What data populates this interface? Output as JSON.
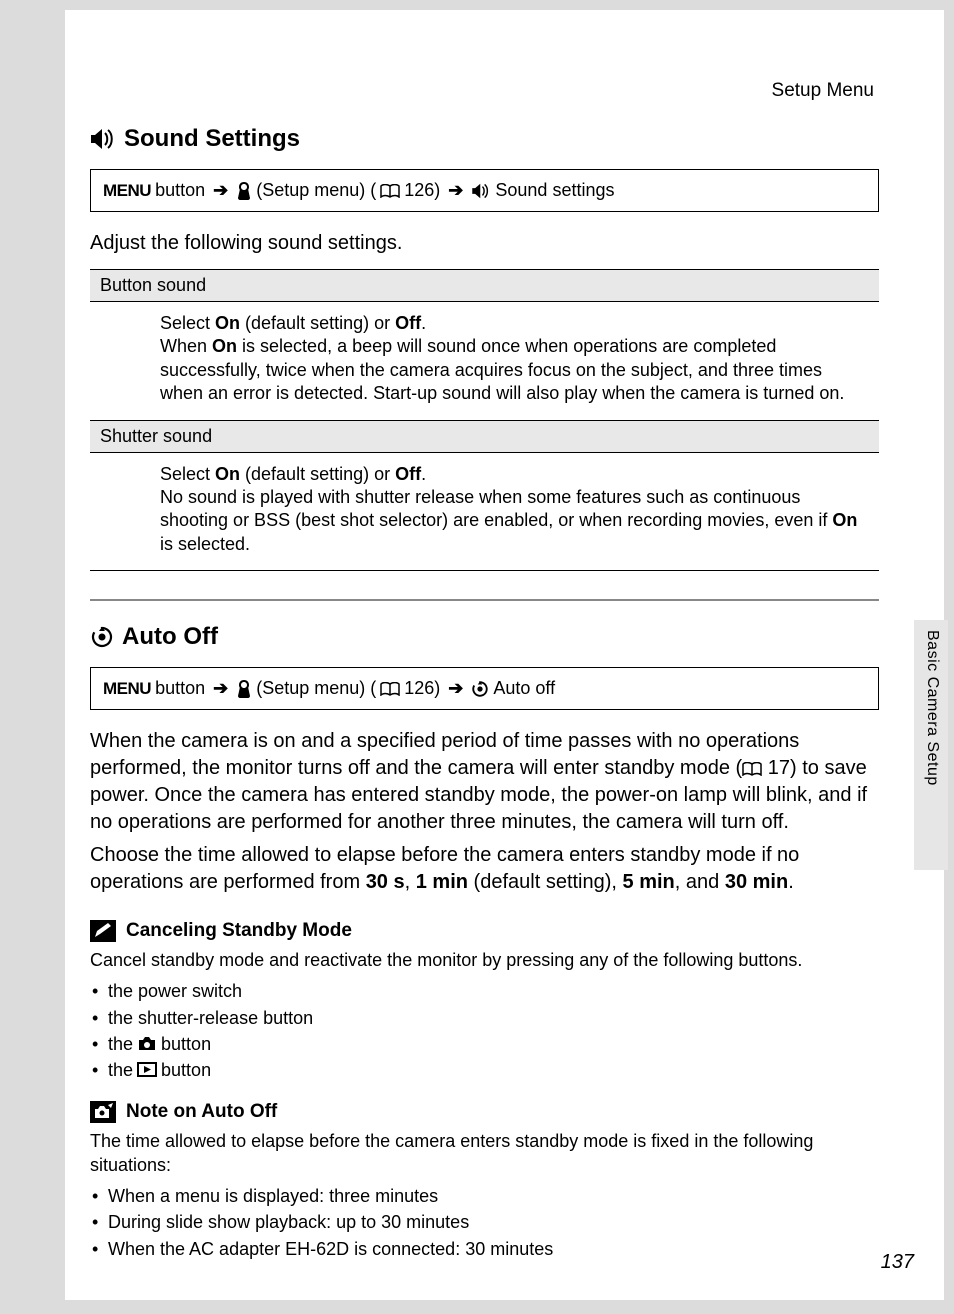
{
  "running_head": "Setup Menu",
  "side_tab": "Basic Camera Setup",
  "page_number": "137",
  "sound": {
    "title": "Sound Settings",
    "nav": {
      "menu": "MENU",
      "btn": " button ",
      "setup": " (Setup menu) (",
      "page": " 126) ",
      "last": " Sound settings"
    },
    "intro": "Adjust the following sound settings.",
    "options": [
      {
        "name": "Button sound",
        "body_pre": "Select ",
        "on": "On",
        "mid1": " (default setting) or ",
        "off": "Off",
        "mid2": ".",
        "line2a": "When ",
        "line2b": " is selected, a beep will sound once when operations are completed successfully, twice when the camera acquires focus on the subject, and three times when an error is detected. Start-up sound will also play when the camera is turned on."
      },
      {
        "name": "Shutter sound",
        "body_pre": "Select ",
        "on": "On",
        "mid1": " (default setting) or ",
        "off": "Off",
        "mid2": ".",
        "line2": "No sound is played with shutter release when some features such as continuous shooting or BSS (best shot selector) are enabled, or when recording movies, even if ",
        "line2b": " is selected."
      }
    ]
  },
  "autooff": {
    "title": "Auto Off",
    "nav": {
      "menu": "MENU",
      "btn": " button ",
      "setup": " (Setup menu) (",
      "page": " 126) ",
      "last": " Auto off"
    },
    "para1a": "When the camera is on and a specified period of time passes with no operations performed, the monitor turns off and the camera will enter standby mode (",
    "para1_page": " 17) to save power. Once the camera has entered standby mode, the power-on lamp will blink, and if no operations are performed for another three minutes, the camera will turn off.",
    "para2a": "Choose the time allowed to elapse before the camera enters standby mode if no operations are performed from ",
    "t1": "30 s",
    "c1": ", ",
    "t2": "1 min",
    "c2": " (default setting), ",
    "t3": "5 min",
    "c3": ", and ",
    "t4": "30 min",
    "c4": ".",
    "cancel": {
      "title": "Canceling Standby Mode",
      "intro": "Cancel standby mode and reactivate the monitor by pressing any of the following buttons.",
      "items": {
        "a": "the power switch",
        "b": "the shutter-release button",
        "c_pre": "the ",
        "c_post": " button",
        "d_pre": "the ",
        "d_post": " button"
      }
    },
    "note": {
      "title": "Note on Auto Off",
      "intro": "The time allowed to elapse before the camera enters standby mode is fixed in the following situations:",
      "items": {
        "a": "When a menu is displayed: three minutes",
        "b": "During slide show playback: up to 30 minutes",
        "c": "When the AC adapter EH-62D is connected: 30 minutes"
      }
    }
  }
}
